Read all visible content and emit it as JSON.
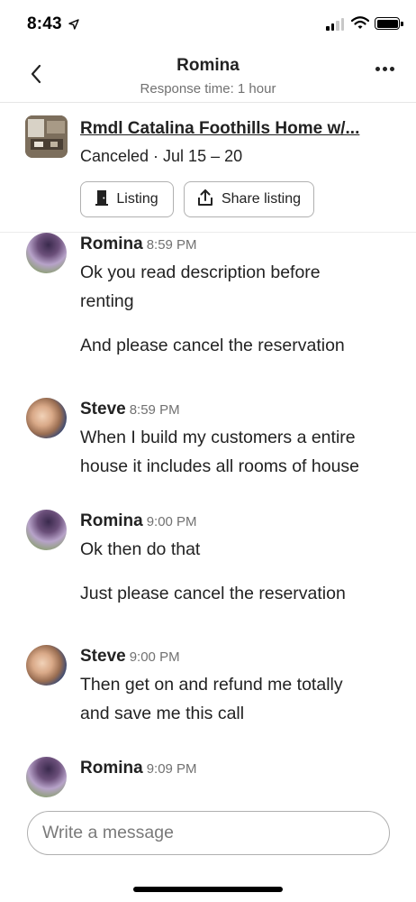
{
  "status_bar": {
    "time": "8:43",
    "icons": [
      "location-arrow-icon",
      "cellular-signal-icon",
      "wifi-icon",
      "battery-icon"
    ]
  },
  "header": {
    "title": "Romina",
    "subtitle": "Response time: 1 hour",
    "back_icon": "chevron-left-icon",
    "more_icon": "more-horizontal-icon"
  },
  "listing": {
    "title": "Rmdl Catalina Foothills Home w/...",
    "status": "Canceled · Jul 15 – 20",
    "listing_button": "Listing",
    "share_button": "Share listing",
    "listing_icon": "door-icon",
    "share_icon": "share-icon"
  },
  "messages": [
    {
      "sender": "Romina",
      "time": "8:59 PM",
      "lines": [
        "Ok you read description before",
        "renting",
        "",
        "And please cancel the reservation"
      ]
    },
    {
      "sender": "Steve",
      "time": "8:59 PM",
      "lines": [
        "When I build my customers a entire",
        "house it includes all rooms of house"
      ]
    },
    {
      "sender": "Romina",
      "time": "9:00 PM",
      "lines": [
        "Ok then do that",
        "",
        "Just please cancel the reservation"
      ]
    },
    {
      "sender": "Steve",
      "time": "9:00 PM",
      "lines": [
        "Then get on and refund me totally",
        "and save me this call"
      ]
    },
    {
      "sender": "Romina",
      "time": "9:09 PM",
      "lines": []
    }
  ],
  "composer": {
    "placeholder": "Write a message"
  },
  "colors": {
    "text_primary": "#222222",
    "text_secondary": "#717171",
    "border": "#b0b0b0"
  }
}
